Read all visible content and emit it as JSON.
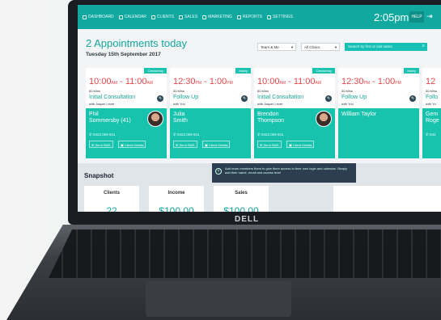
{
  "nav": {
    "items": [
      {
        "label": "DASHBOARD",
        "icon": "dashboard-icon"
      },
      {
        "label": "CALENDAR",
        "icon": "calendar-icon"
      },
      {
        "label": "CLIENTS",
        "icon": "clients-icon"
      },
      {
        "label": "SALES",
        "icon": "sales-icon"
      },
      {
        "label": "MARKETING",
        "icon": "marketing-icon"
      },
      {
        "label": "REPORTS",
        "icon": "reports-icon"
      },
      {
        "label": "SETTINGS",
        "icon": "settings-icon"
      }
    ],
    "time": "2:05pm",
    "help": "HELP"
  },
  "header": {
    "title": "2 Appointments today",
    "date": "Tuesday 15th September 2017",
    "team_filter": "Team & Me",
    "clinic_filter": "All Clinics",
    "search_placeholder": "Search by first or last name"
  },
  "appointments": [
    {
      "tag": "Cammeray",
      "start": "10:00",
      "start_suffix": "AM",
      "end": "11:00",
      "end_suffix": "AM",
      "duration": "60 Mins",
      "service": "Initial Consultation",
      "with": "with Jasper Lever",
      "client": "Phil\nSommersby (41)",
      "phone": "0423 009 941",
      "sms": "Send SMS",
      "details": "Client Details",
      "avatar": true
    },
    {
      "tag": "Manly",
      "start": "12:30",
      "start_suffix": "PM",
      "end": "1:00",
      "end_suffix": "PM",
      "duration": "30 Mins",
      "service": "Follow Up",
      "with": "with You",
      "client": "Julia\nSmith",
      "phone": "0423 009 941",
      "sms": "Send SMS",
      "details": "Client Details",
      "avatar": false
    },
    {
      "tag": "Cammeray",
      "start": "10:00",
      "start_suffix": "AM",
      "end": "11:00",
      "end_suffix": "AM",
      "duration": "60 Mins",
      "service": "Initial Consultation",
      "with": "with Jasper Lever",
      "client": "Brendon\nThompson",
      "phone": "0423 009 941",
      "sms": "Send SMS",
      "details": "Client Details",
      "avatar": true
    },
    {
      "tag": "Manly",
      "start": "12:30",
      "start_suffix": "PM",
      "end": "1:00",
      "end_suffix": "PM",
      "duration": "30 Mins",
      "service": "Follow Up",
      "with": "with You",
      "client": "William Taylor",
      "phone": "",
      "sms": "",
      "details": "",
      "avatar": false
    },
    {
      "tag": "",
      "start": "12",
      "start_suffix": "",
      "end": "",
      "end_suffix": "",
      "duration": "30 Mins",
      "service": "Follo",
      "with": "with Yo",
      "client": "Gem\nRoge",
      "phone": "042",
      "sms": "",
      "details": "",
      "avatar": false
    }
  ],
  "snapshot": {
    "title": "Snapshot",
    "tooltip": "Add team members them to give them access to their own login and calendar. Simply add their name, email and access level",
    "stats": [
      {
        "label": "Clients",
        "value": "22"
      },
      {
        "label": "Income",
        "value": "$100.00"
      },
      {
        "label": "Sales",
        "value": "$100.00"
      }
    ]
  },
  "laptop": {
    "brand": "DELL"
  }
}
